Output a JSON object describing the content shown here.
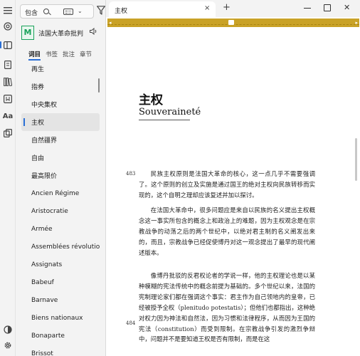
{
  "rail": {
    "icons": [
      "at-icon",
      "sidebar-panel-icon",
      "document-icon",
      "library-icon",
      "bookmark-icon",
      "chart-icon",
      "font-icon",
      "copy-icon",
      "theme-icon",
      "settings-icon"
    ]
  },
  "sidebar": {
    "search_text": "包含",
    "book_badge": "M",
    "book_title": "法国大革命批判",
    "tabs": [
      "词目",
      "书签",
      "批注",
      "章节"
    ],
    "items": [
      "再生",
      "指券",
      "中央集权",
      "主权",
      "自然疆界",
      "自由",
      "最高限价",
      "Ancien Régime",
      "Aristocratie",
      "Armée",
      "Assemblées révolutionnaires",
      "Assignats",
      "Babeuf",
      "Barnave",
      "Biens nationaux",
      "Bonaparte",
      "Brissot"
    ],
    "selected_index": 3
  },
  "window": {
    "tab_title": "主权",
    "close": "×",
    "new_tab": "+",
    "win_close": "✕"
  },
  "reader": {
    "heading": "主权",
    "subheading": "Souveraineté",
    "page_483": "483",
    "page_484": "484",
    "para1": "民族主权原则是法国大革命的核心，这一点几乎不需要强调了。这个原则的创立及实施是通过国王的绝对主权向民族转移而实现的，这个自明之理却应该复述并加以探讨。",
    "para2": "在法国大革命中，很多问题应是来自以民族的名义提出主权概念这一事实所包含的概念上和政治上的难题，因为主权观念是在宗教战争的动荡之后的两个世纪中，以绝对君主制的名义阐发出来的，而且，宗教战争已经促使博丹对这一观念提出了最早的现代阐述版本。",
    "para3": "像博丹批驳的反君权论者的学说一样，他的主权理论也是以某种模糊的宪法传统中的概念前提为基础的。多个世纪以来，法国的宪制理论家们都在强调这个事实：君主作为自己领地内的皇帝，已经被授予全权（plenitudo potestatis）；但他们也都指出，这种绝对权力因为神法和自然法，因为习惯和法律程序，从而因为王国的宪法（constitution）而受到限制。在宗教战争引发的激烈争辩中，问题并不是要知道王权是否有限制，而是在这"
  }
}
